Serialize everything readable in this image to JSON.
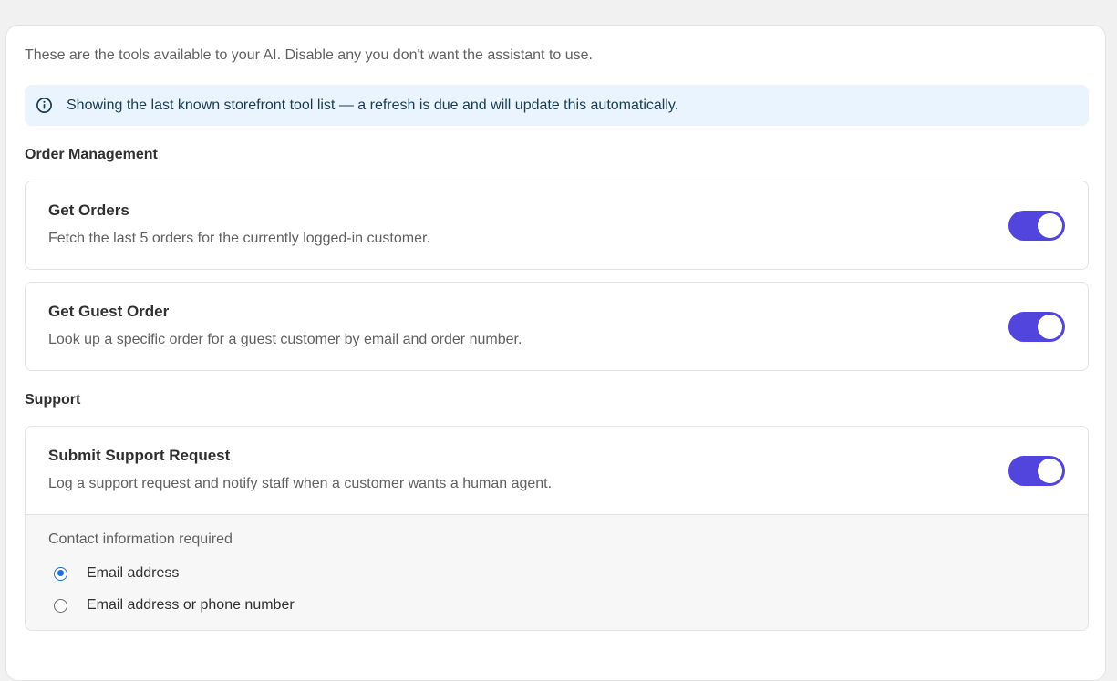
{
  "intro_text": "These are the tools available to your AI. Disable any you don't want the assistant to use.",
  "banner": {
    "icon": "info-icon",
    "text": "Showing the last known storefront tool list — a refresh is due and will update this automatically."
  },
  "sections": {
    "order_management": {
      "title": "Order Management",
      "tools": [
        {
          "name": "Get Orders",
          "description": "Fetch the last 5 orders for the currently logged-in customer.",
          "enabled": true
        },
        {
          "name": "Get Guest Order",
          "description": "Look up a specific order for a guest customer by email and order number.",
          "enabled": true
        }
      ]
    },
    "support": {
      "title": "Support",
      "tools": [
        {
          "name": "Submit Support Request",
          "description": "Log a support request and notify staff when a customer wants a human agent.",
          "enabled": true
        }
      ],
      "contact": {
        "label": "Contact information required",
        "options": [
          {
            "label": "Email address",
            "selected": true
          },
          {
            "label": "Email address or phone number",
            "selected": false
          }
        ]
      }
    }
  },
  "colors": {
    "accent": "#5145dd",
    "radio_selected": "#1f6fe0",
    "banner_bg": "#eaf4fe"
  }
}
